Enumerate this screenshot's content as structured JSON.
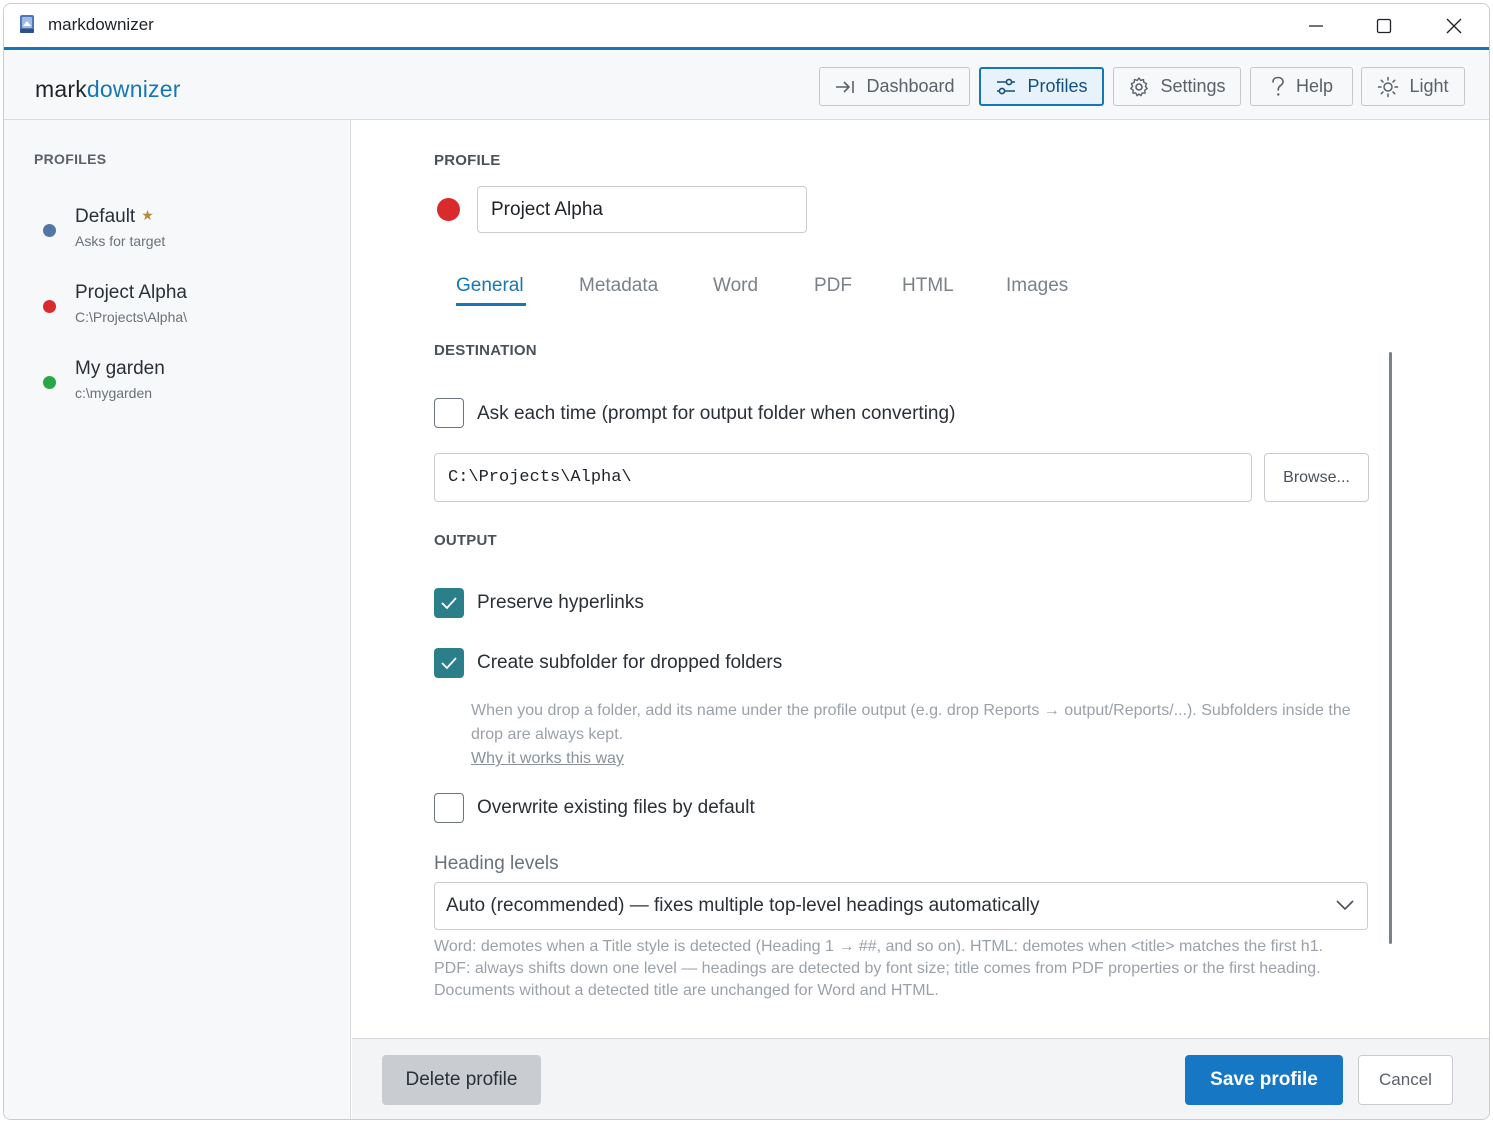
{
  "window": {
    "title": "markdownizer",
    "icon": "app-icon"
  },
  "header": {
    "brand_part1": "mark",
    "brand_part2": "downizer",
    "nav": [
      {
        "label": "Dashboard",
        "icon": "arrow-to-line-icon",
        "active": false
      },
      {
        "label": "Profiles",
        "icon": "sliders-icon",
        "active": true
      },
      {
        "label": "Settings",
        "icon": "gear-icon",
        "active": false
      },
      {
        "label": "Help",
        "icon": "question-icon",
        "active": false
      },
      {
        "label": "Light",
        "icon": "sun-icon",
        "active": false
      }
    ]
  },
  "sidebar": {
    "heading": "PROFILES",
    "profiles": [
      {
        "name": "Default",
        "path": "Asks for target",
        "color": "#5276a6",
        "is_default": true,
        "star": "★"
      },
      {
        "name": "Project Alpha",
        "path": "C:\\Projects\\Alpha\\",
        "color": "#d92b2b",
        "is_default": false
      },
      {
        "name": "My garden",
        "path": "c:\\mygarden",
        "color": "#2aa745",
        "is_default": false
      }
    ]
  },
  "main": {
    "profile_label": "PROFILE",
    "profile_color": "#d92b2b",
    "profile_name": "Project Alpha",
    "tabs": [
      {
        "label": "General",
        "active": true
      },
      {
        "label": "Metadata",
        "active": false
      },
      {
        "label": "Word",
        "active": false
      },
      {
        "label": "PDF",
        "active": false
      },
      {
        "label": "HTML",
        "active": false
      },
      {
        "label": "Images",
        "active": false
      }
    ],
    "destination": {
      "label": "DESTINATION",
      "ask_each_time": {
        "label": "Ask each time (prompt for output folder when converting)",
        "checked": false
      },
      "path_value": "C:\\Projects\\Alpha\\",
      "browse_label": "Browse..."
    },
    "output": {
      "label": "OUTPUT",
      "preserve_hyperlinks": {
        "label": "Preserve hyperlinks",
        "checked": true
      },
      "create_subfolder": {
        "label": "Create subfolder for dropped folders",
        "checked": true
      },
      "subfolder_help": "When you drop a folder, add its name under the profile output (e.g. drop Reports → output/Reports/...). Subfolders inside the drop are always kept.",
      "subfolder_link": "Why it works this way",
      "overwrite": {
        "label": "Overwrite existing files by default",
        "checked": false
      }
    },
    "heading_levels": {
      "label": "Heading levels",
      "selected": "Auto (recommended) — fixes multiple top-level headings automatically",
      "note_line1": "Word: demotes when a Title style is detected (Heading 1 → ##, and so on). HTML: demotes when <title> matches the first h1.",
      "note_line2": "PDF: always shifts down one level — headings are detected by font size; title comes from PDF properties or the first heading.",
      "note_line3": "Documents without a detected title are unchanged for Word and HTML."
    }
  },
  "footer": {
    "delete_label": "Delete profile",
    "save_label": "Save profile",
    "cancel_label": "Cancel"
  },
  "colors": {
    "accent": "#1677b8",
    "checkbox_checked": "#2b7f8b",
    "save_button": "#1677c4"
  }
}
